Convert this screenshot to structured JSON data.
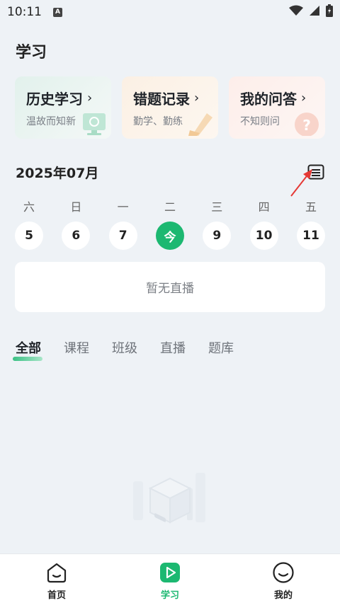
{
  "status_bar": {
    "time": "10:11",
    "notification_icon": "a-letter-icon"
  },
  "page": {
    "title": "学习"
  },
  "cards": [
    {
      "title": "历史学习",
      "subtitle": "温故而知新",
      "icon": "monitor-icon"
    },
    {
      "title": "错题记录",
      "subtitle": "勤学、勤练",
      "icon": "pencil-icon"
    },
    {
      "title": "我的问答",
      "subtitle": "不知则问",
      "icon": "question-icon"
    }
  ],
  "card_chevron": "›",
  "calendar": {
    "month_label": "2025年07月",
    "weekdays": [
      "六",
      "日",
      "一",
      "二",
      "三",
      "四",
      "五"
    ],
    "days": [
      "5",
      "6",
      "7",
      "今",
      "9",
      "10",
      "11"
    ],
    "today_index": 3,
    "accent_color": "#1cb871"
  },
  "live": {
    "empty_text": "暂无直播"
  },
  "tabs": [
    {
      "label": "全部",
      "active": true
    },
    {
      "label": "课程",
      "active": false
    },
    {
      "label": "班级",
      "active": false
    },
    {
      "label": "直播",
      "active": false
    },
    {
      "label": "题库",
      "active": false
    }
  ],
  "bottom_nav": [
    {
      "label": "首页",
      "icon": "home-icon",
      "active": false
    },
    {
      "label": "学习",
      "icon": "play-icon",
      "active": true
    },
    {
      "label": "我的",
      "icon": "smile-icon",
      "active": false
    }
  ]
}
